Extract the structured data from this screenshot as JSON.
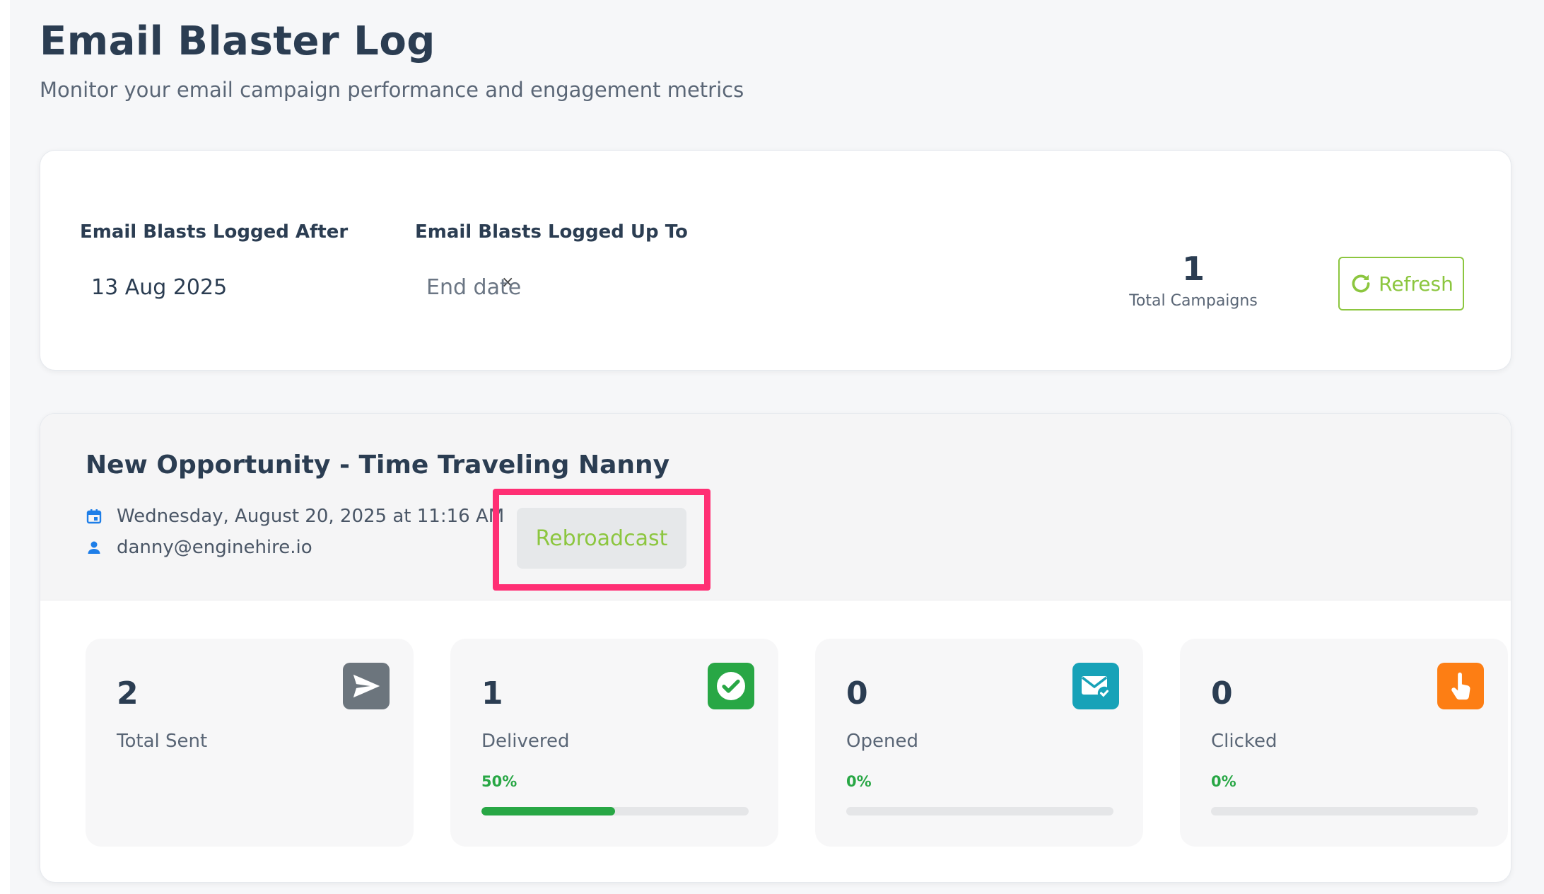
{
  "header": {
    "title": "Email Blaster Log",
    "subtitle": "Monitor your email campaign performance and engagement metrics"
  },
  "filters": {
    "after_label": "Email Blasts Logged After",
    "after_value": "13 Aug 2025",
    "clear_symbol": "×",
    "upto_label": "Email Blasts Logged Up To",
    "upto_placeholder": "End date",
    "total_campaigns_value": "1",
    "total_campaigns_label": "Total Campaigns",
    "refresh_label": "Refresh",
    "refresh_icon": "refresh-icon"
  },
  "campaign": {
    "title": "New Opportunity - Time Traveling Nanny",
    "date": "Wednesday, August 20, 2025 at 11:16 AM",
    "date_icon": "calendar-icon",
    "sender": "danny@enginehire.io",
    "sender_icon": "user-icon",
    "rebroadcast_label": "Rebroadcast",
    "highlight_color": "#ff2f74",
    "metrics": [
      {
        "value": "2",
        "label": "Total Sent",
        "icon": "send-icon",
        "icon_color": "#6c757d"
      },
      {
        "value": "1",
        "label": "Delivered",
        "pct_label": "50%",
        "pct": 50,
        "icon": "check-circle-icon",
        "icon_color": "#28a745"
      },
      {
        "value": "0",
        "label": "Opened",
        "pct_label": "0%",
        "pct": 0,
        "icon": "envelope-open-icon",
        "icon_color": "#17a2b8"
      },
      {
        "value": "0",
        "label": "Clicked",
        "pct_label": "0%",
        "pct": 0,
        "icon": "pointer-hand-icon",
        "icon_color": "#fd7e14"
      }
    ]
  },
  "colors": {
    "accent_green": "#8cc63f",
    "success": "#28a745",
    "text_dark": "#2b3d52"
  }
}
